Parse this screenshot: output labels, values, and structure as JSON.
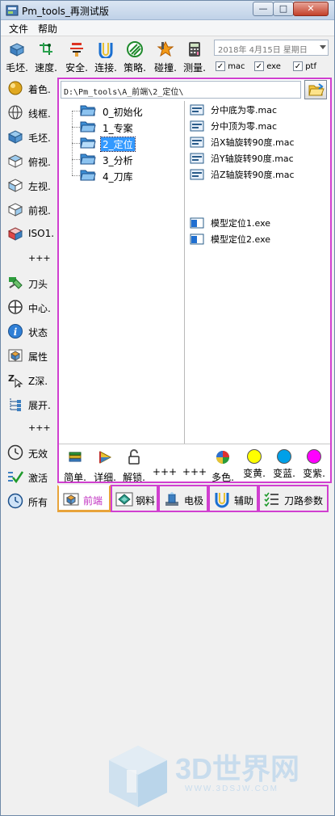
{
  "window": {
    "title": "Pm_tools_再测试版"
  },
  "menu": {
    "file": "文件",
    "help": "帮助"
  },
  "toolbar": {
    "items": [
      {
        "label": "毛坯."
      },
      {
        "label": "速度."
      },
      {
        "label": "安全."
      },
      {
        "label": "连接."
      },
      {
        "label": "策略."
      },
      {
        "label": "碰撞."
      },
      {
        "label": "测量."
      }
    ],
    "date_value": "2018年 4月15日  星期日",
    "checkboxes": [
      {
        "label": "mac",
        "checked": true
      },
      {
        "label": "exe",
        "checked": true
      },
      {
        "label": "ptf",
        "checked": true
      }
    ]
  },
  "sidebar": {
    "items": [
      {
        "label": "着色."
      },
      {
        "label": "线框."
      },
      {
        "label": "毛坯."
      },
      {
        "label": "俯视."
      },
      {
        "label": "左视."
      },
      {
        "label": "前视."
      },
      {
        "label": "ISO1."
      },
      {
        "label": "+++"
      },
      {
        "label": "刀头"
      },
      {
        "label": "中心."
      },
      {
        "label": "状态"
      },
      {
        "label": "属性"
      },
      {
        "label": "Z深."
      },
      {
        "label": "展开."
      },
      {
        "label": "+++"
      },
      {
        "label": "无效"
      },
      {
        "label": "激活"
      },
      {
        "label": "所有"
      }
    ]
  },
  "path": {
    "value": "D:\\Pm_tools\\A_前端\\2_定位\\"
  },
  "tree": {
    "items": [
      {
        "label": "0_初始化"
      },
      {
        "label": "1_专案"
      },
      {
        "label": "2_定位",
        "selected": true
      },
      {
        "label": "3_分析"
      },
      {
        "label": "4_刀库"
      }
    ]
  },
  "files": {
    "mac": [
      {
        "label": "分中底为零.mac"
      },
      {
        "label": "分中顶为零.mac"
      },
      {
        "label": "沿X轴旋转90度.mac"
      },
      {
        "label": "沿Y轴旋转90度.mac"
      },
      {
        "label": "沿Z轴旋转90度.mac"
      }
    ],
    "exe": [
      {
        "label": "模型定位1.exe"
      },
      {
        "label": "模型定位2.exe"
      }
    ]
  },
  "bottom_tools": [
    {
      "label": "简单."
    },
    {
      "label": "详细."
    },
    {
      "label": "解锁."
    },
    {
      "label": "+++"
    },
    {
      "label": "+++"
    },
    {
      "label": "多色."
    },
    {
      "label": "变黄."
    },
    {
      "label": "变蓝."
    },
    {
      "label": "变紫."
    }
  ],
  "colors": {
    "yellow": "#ffff00",
    "blue": "#00a0e8",
    "magenta": "#ff00ff",
    "accent": "#d03fd0",
    "tab_active": "#e8a33a",
    "selection": "#3399ff"
  },
  "tabs": [
    {
      "label": "前端",
      "active": true
    },
    {
      "label": "钢料"
    },
    {
      "label": "电极"
    },
    {
      "label": "辅助"
    },
    {
      "label": "刀路参数"
    }
  ],
  "watermark": {
    "brand": "3D世界网",
    "url": "WWW.3DSJW.COM"
  }
}
